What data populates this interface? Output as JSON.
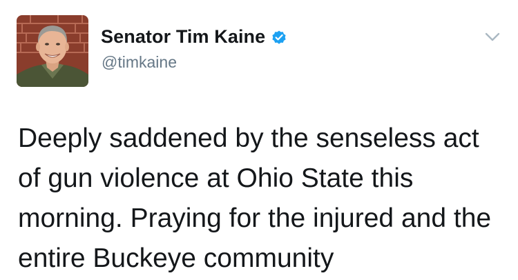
{
  "author": {
    "display_name": "Senator Tim Kaine",
    "handle": "@timkaine",
    "verified": true,
    "avatar_icon": "profile-photo",
    "verified_icon": "verified-badge-icon"
  },
  "menu": {
    "icon": "chevron-down-icon"
  },
  "tweet": {
    "text": "Deeply saddened by the senseless act\nof gun violence at Ohio State this\nmorning. Praying for the injured and the\nentire Buckeye community"
  },
  "colors": {
    "verified_blue": "#1da1f2",
    "handle_gray": "#657786",
    "text": "#14171a",
    "caret_gray": "#aab8c2"
  }
}
